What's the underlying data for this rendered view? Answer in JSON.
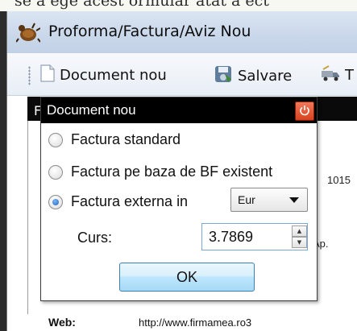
{
  "top_strip": {
    "text": "se a ege acest ormular atat a ect"
  },
  "window": {
    "title": "Proforma/Factura/Aviz Nou"
  },
  "toolbar": {
    "new_document_label": "Document nou",
    "save_label": "Salvare",
    "third_label": "T"
  },
  "background_form": {
    "header_letter": "F",
    "text_1": "1015",
    "text_2": "Ap.",
    "web_label": "Web:",
    "web_value": "http://www.firmamea.ro3"
  },
  "dialog": {
    "title": "Document nou",
    "options": [
      {
        "label": "Factura standard",
        "checked": false
      },
      {
        "label": "Factura pe baza de BF existent",
        "checked": false
      },
      {
        "label": "Factura externa in",
        "checked": true
      }
    ],
    "currency": {
      "selected": "Eur"
    },
    "curs_label": "Curs:",
    "curs_value": "3.7869",
    "ok_label": "OK"
  },
  "colors": {
    "title_bar": "#c9d7ea",
    "dialog_title_bar": "#000000",
    "close_button": "#d9411d",
    "ok_button": "#bee6fd",
    "radio_selected": "#1d64c4"
  },
  "icons": {
    "app": "bug-app-icon",
    "new_document": "document-icon",
    "save": "save-disk-icon",
    "third": "truck-icon",
    "close": "power-close-icon",
    "dropdown": "chevron-down-icon"
  }
}
